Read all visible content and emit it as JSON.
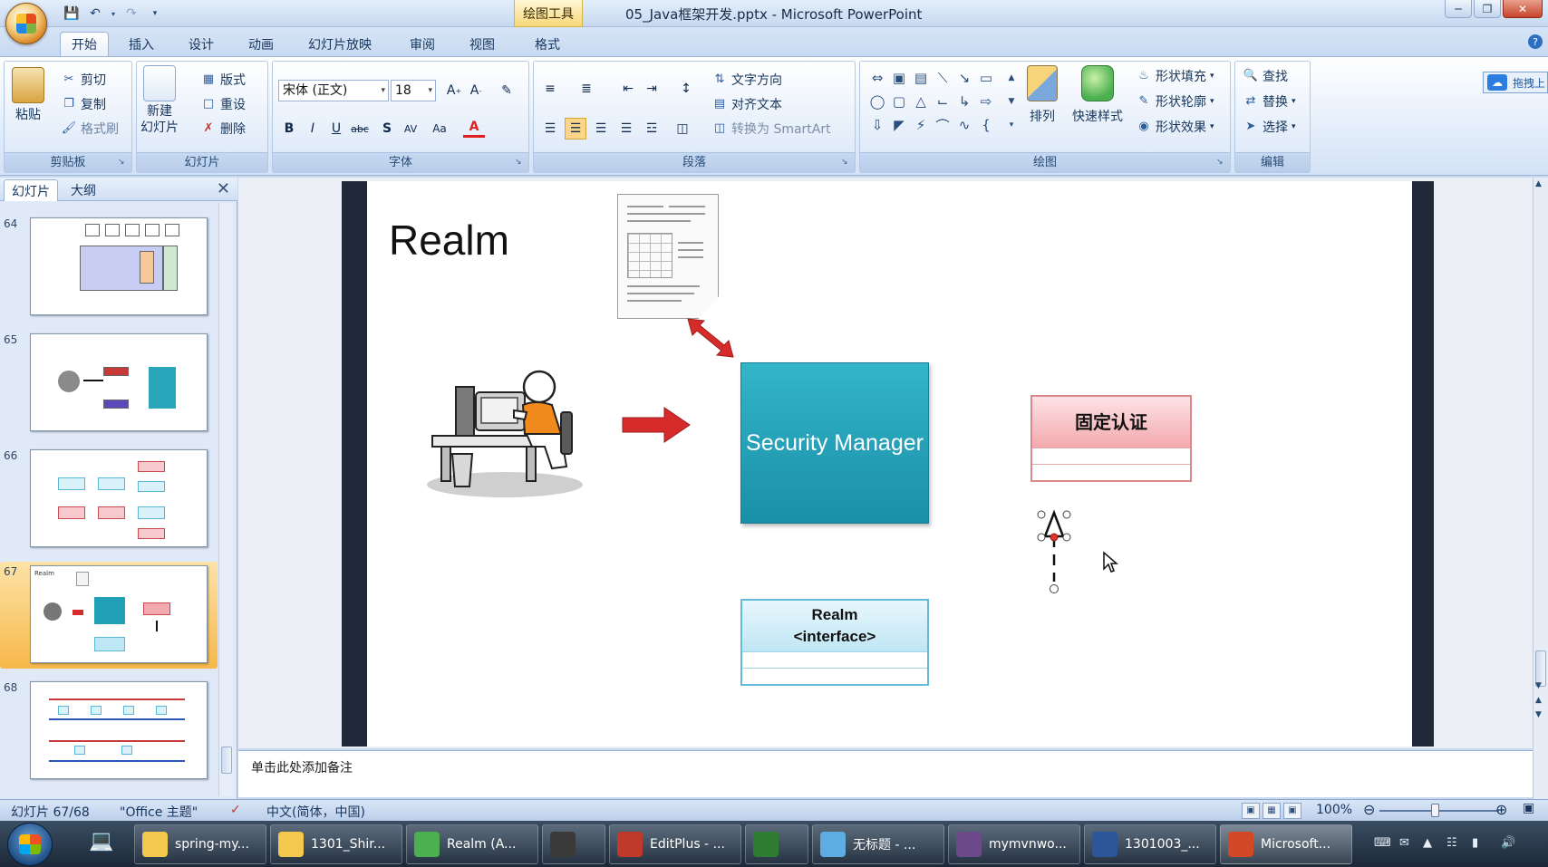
{
  "window": {
    "contextual_tab": "绘图工具",
    "title": "05_Java框架开发.pptx - Microsoft PowerPoint"
  },
  "ribbon_tabs": [
    "开始",
    "插入",
    "设计",
    "动画",
    "幻灯片放映",
    "审阅",
    "视图",
    "格式"
  ],
  "ribbon": {
    "clipboard": {
      "label": "剪贴板",
      "paste": "粘贴",
      "cut": "剪切",
      "copy": "复制",
      "format_painter": "格式刷"
    },
    "slides": {
      "label": "幻灯片",
      "new_slide_1": "新建",
      "new_slide_2": "幻灯片",
      "layout": "版式",
      "reset": "重设",
      "delete": "删除"
    },
    "font": {
      "label": "字体",
      "font_name": "宋体 (正文)",
      "font_size": "18"
    },
    "paragraph": {
      "label": "段落",
      "text_direction": "文字方向",
      "align_text": "对齐文本",
      "convert_smartart": "转换为 SmartArt"
    },
    "drawing": {
      "label": "绘图",
      "arrange": "排列",
      "quick_styles": "快速样式",
      "shape_fill": "形状填充",
      "shape_outline": "形状轮廓",
      "shape_effects": "形状效果"
    },
    "editing": {
      "label": "编辑",
      "find": "查找",
      "replace": "替换",
      "select": "选择"
    },
    "share": "拖拽上"
  },
  "left_panel": {
    "tab_slides": "幻灯片",
    "tab_outline": "大纲",
    "thumbnails": [
      {
        "number": "64"
      },
      {
        "number": "65"
      },
      {
        "number": "66"
      },
      {
        "number": "67",
        "selected": true
      },
      {
        "number": "68"
      }
    ]
  },
  "slide": {
    "title": "Realm",
    "security_manager": "Security Manager",
    "realm_interface_line1": "Realm",
    "realm_interface_line2": "<interface>",
    "fixed_auth": "固定认证"
  },
  "notes": {
    "placeholder": "单击此处添加备注"
  },
  "status": {
    "slide_counter": "幻灯片 67/68",
    "theme": "\"Office 主题\"",
    "language": "中文(简体，中国)",
    "zoom": "100%"
  },
  "taskbar": [
    {
      "label": "spring-my...",
      "icon": "folder-icon",
      "color": "#f2c94c"
    },
    {
      "label": "1301_Shir...",
      "icon": "folder-icon",
      "color": "#f2c94c"
    },
    {
      "label": "Realm (A...",
      "icon": "chrome-icon",
      "color": "#4caf50"
    },
    {
      "label": "",
      "icon": "sublime-icon",
      "color": "#3a3a3a"
    },
    {
      "label": "EditPlus - ...",
      "icon": "editplus-icon",
      "color": "#c0392b"
    },
    {
      "label": "",
      "icon": "app-icon",
      "color": "#2e7d32"
    },
    {
      "label": "无标题 - ...",
      "icon": "paint-icon",
      "color": "#5dade2"
    },
    {
      "label": "mymvnwo...",
      "icon": "eclipse-icon",
      "color": "#6c4a8a"
    },
    {
      "label": "1301003_...",
      "icon": "word-icon",
      "color": "#2b579a"
    },
    {
      "label": "Microsoft...",
      "icon": "powerpoint-icon",
      "color": "#d24726",
      "active": true
    }
  ],
  "colors": {
    "security_manager_fill": "#22a0b8",
    "realm_header_fill": "#bfe6f4",
    "fixed_header_fill": "#f3a9ae",
    "arrow_red": "#d62b2b"
  }
}
